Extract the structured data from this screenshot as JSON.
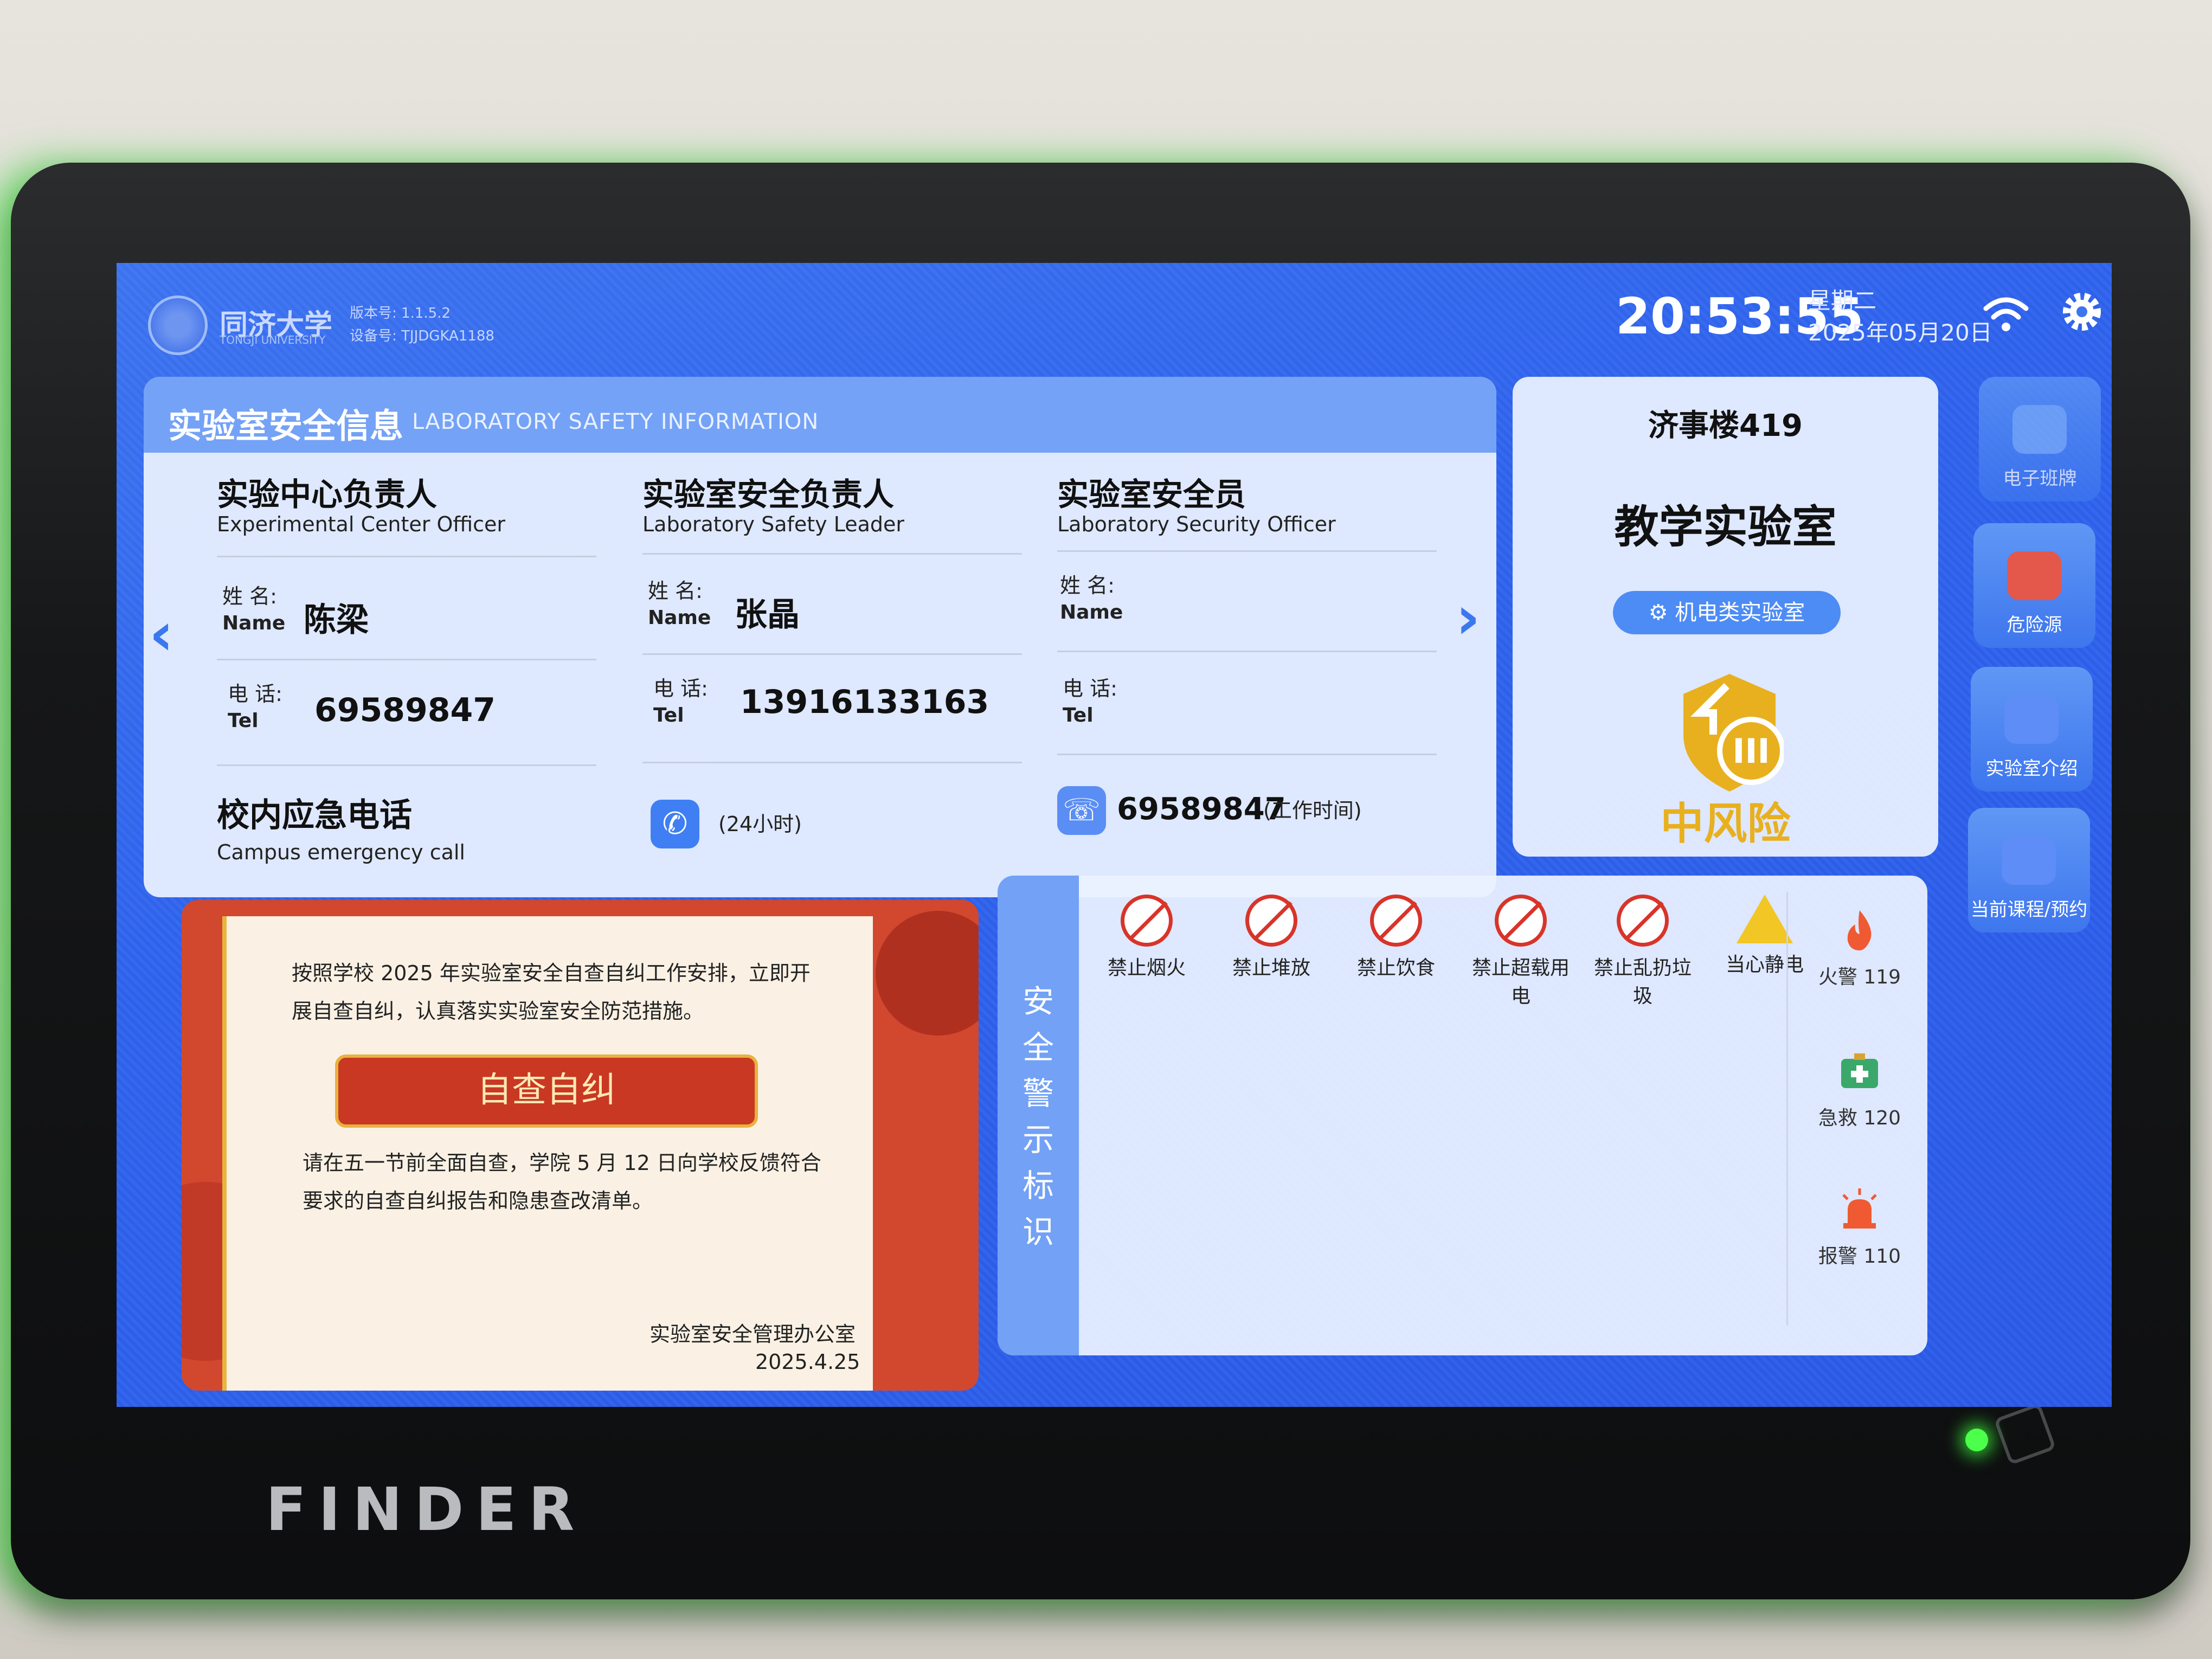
{
  "header": {
    "school_name": "同济大学",
    "school_name_en": "TONGJI UNIVERSITY",
    "version_label": "版本号: 1.1.5.2",
    "device_label": "设备号: TJJDGKA1188",
    "time": "20:53:55",
    "weekday": "星期二",
    "date": "2025年05月20日",
    "icons": [
      "wifi-icon",
      "gear-icon"
    ]
  },
  "safety_info": {
    "title": "实验室安全信息",
    "subtitle": "LABORATORY SAFETY INFORMATION",
    "columns": [
      {
        "role": "实验中心负责人",
        "role_en": "Experimental Center Officer",
        "name_label": "姓 名:",
        "name_label_en": "Name",
        "name": "陈梁",
        "tel_label": "电 话:",
        "tel_label_en": "Tel",
        "tel": "69589847"
      },
      {
        "role": "实验室安全负责人",
        "role_en": "Laboratory Safety Leader",
        "name_label": "姓 名:",
        "name_label_en": "Name",
        "name": "张晶",
        "tel_label": "电 话:",
        "tel_label_en": "Tel",
        "tel": "13916133163"
      },
      {
        "role": "实验室安全员",
        "role_en": "Laboratory Security Officer",
        "name_label": "姓 名:",
        "name_label_en": "Name",
        "name": "",
        "tel_label": "电 话:",
        "tel_label_en": "Tel",
        "tel": ""
      }
    ],
    "emergency": {
      "title": "校内应急电话",
      "title_en": "Campus emergency call",
      "hotline_note": "(24小时)",
      "office_number": "69589847",
      "office_note": "(工作时间)"
    }
  },
  "room": {
    "building": "济事楼419",
    "name": "教学实验室",
    "category": "机电类实验室",
    "risk_level_badge": "III",
    "risk_text": "中风险",
    "risk_color": "#e8b01e"
  },
  "side_nav": [
    {
      "label": "电子班牌",
      "icon": "monitor-icon"
    },
    {
      "label": "危险源",
      "icon": "hazard-icon"
    },
    {
      "label": "实验室介绍",
      "icon": "flask-icon"
    },
    {
      "label": "当前课程/预约",
      "icon": "calendar-icon"
    }
  ],
  "notice": {
    "line1": "按照学校 2025 年实验室安全自查自纠工作安排，立即开",
    "line2": "展自查自纠，认真落实实验室安全防范措施。",
    "button": "自查自纠",
    "line3": "请在五一节前全面自查，学院 5 月 12 日向学校反馈符合",
    "line4": "要求的自查自纠报告和隐患查改清单。",
    "signer": "实验室安全管理办公室",
    "date": "2025.4.25"
  },
  "warnings": {
    "title": "安全警示标识",
    "signs": [
      {
        "label": "禁止烟火",
        "icon": "no-fire-icon"
      },
      {
        "label": "禁止堆放",
        "icon": "no-stacking-icon"
      },
      {
        "label": "禁止饮食",
        "icon": "no-food-icon"
      },
      {
        "label": "禁止超载用电",
        "icon": "no-overload-icon"
      },
      {
        "label": "禁止乱扔垃圾",
        "icon": "no-litter-icon"
      },
      {
        "label": "当心静电",
        "icon": "static-warning-icon"
      }
    ],
    "emergency_numbers": [
      {
        "label": "火警 119",
        "icon": "fire-icon"
      },
      {
        "label": "急救 120",
        "icon": "first-aid-icon"
      },
      {
        "label": "报警 110",
        "icon": "alarm-icon"
      }
    ]
  },
  "device": {
    "brand": "FINDER"
  },
  "colors": {
    "screen_blue": "#2f63ee",
    "header_blue": "#74a2f6",
    "notice_red": "#c83823",
    "risk_yellow": "#e8b01e"
  }
}
